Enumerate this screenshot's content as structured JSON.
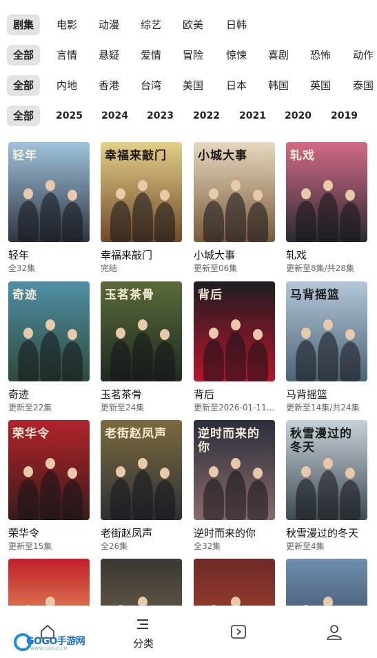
{
  "filters": {
    "type": {
      "items": [
        "剧集",
        "电影",
        "动漫",
        "综艺",
        "欧美",
        "日韩"
      ],
      "selected": "剧集"
    },
    "genre": {
      "items": [
        "全部",
        "言情",
        "悬疑",
        "爱情",
        "冒险",
        "惊悚",
        "喜剧",
        "恐怖",
        "动作"
      ],
      "selected": "全部"
    },
    "region": {
      "items": [
        "全部",
        "内地",
        "香港",
        "台湾",
        "美国",
        "日本",
        "韩国",
        "英国",
        "泰国"
      ],
      "selected": "全部"
    },
    "year": {
      "items": [
        "全部",
        "2025",
        "2024",
        "2023",
        "2022",
        "2021",
        "2020",
        "2019"
      ],
      "selected": "全部"
    }
  },
  "shows": [
    {
      "name": "轻年",
      "status": "全32集",
      "poster_text": "轻年",
      "colors": [
        "#9fc3dd",
        "#2d3440"
      ]
    },
    {
      "name": "幸福来敲门",
      "status": "完结",
      "poster_text": "幸福来敲门",
      "colors": [
        "#e4cf86",
        "#6e4a2a"
      ]
    },
    {
      "name": "小城大事",
      "status": "更新至06集",
      "poster_text": "小城大事",
      "colors": [
        "#e6d8bf",
        "#7a5a3a"
      ]
    },
    {
      "name": "轧戏",
      "status": "更新至8集/共28集",
      "poster_text": "轧戏",
      "colors": [
        "#d46a86",
        "#2a2a33"
      ]
    },
    {
      "name": "奇迹",
      "status": "更新至22集",
      "poster_text": "奇迹",
      "colors": [
        "#4f8fa6",
        "#2d4b3c"
      ]
    },
    {
      "name": "玉茗茶骨",
      "status": "更新至24集",
      "poster_text": "玉茗茶骨",
      "colors": [
        "#5a6b3a",
        "#1d2a1f"
      ]
    },
    {
      "name": "背后",
      "status": "更新至2026-01-11...",
      "poster_text": "背后",
      "colors": [
        "#1d1d22",
        "#b8152a"
      ]
    },
    {
      "name": "马背摇篮",
      "status": "更新至14集/共24集",
      "poster_text": "马背摇篮",
      "colors": [
        "#b3c7d8",
        "#4b6478"
      ]
    },
    {
      "name": "荣华令",
      "status": "更新至15集",
      "poster_text": "荣华令",
      "colors": [
        "#b3232b",
        "#3a1c18"
      ]
    },
    {
      "name": "老街赵凤声",
      "status": "全26集",
      "poster_text": "老街赵凤声",
      "colors": [
        "#7c6a3e",
        "#2c3036"
      ]
    },
    {
      "name": "逆时而来的你",
      "status": "全32集",
      "poster_text": "逆时而来的你",
      "colors": [
        "#2a2e3c",
        "#8a6a6a"
      ]
    },
    {
      "name": "秋雪漫过的冬天",
      "status": "更新至4集",
      "poster_text": "秋雪漫过的冬天",
      "colors": [
        "#c7d2d8",
        "#3e4a52"
      ]
    },
    {
      "name": "",
      "status": "",
      "poster_text": "",
      "colors": [
        "#c21f2a",
        "#f0c070"
      ]
    },
    {
      "name": "",
      "status": "",
      "poster_text": "",
      "colors": [
        "#3b3832",
        "#7d6e55"
      ]
    },
    {
      "name": "",
      "status": "",
      "poster_text": "",
      "colors": [
        "#6e2a28",
        "#b34a30"
      ]
    },
    {
      "name": "",
      "status": "",
      "poster_text": "",
      "colors": [
        "#6f8fb0",
        "#2c3a4a"
      ]
    }
  ],
  "tabbar": {
    "home_icon": "home-icon",
    "category_label": "分类",
    "category_icon": "list-icon",
    "video_icon": "play-icon",
    "profile_icon": "user-icon"
  },
  "watermark": {
    "logo_text": "GOGO手游网",
    "logo_sub": "WWW.GOGO.CN",
    "color": "#1a6fd0"
  }
}
